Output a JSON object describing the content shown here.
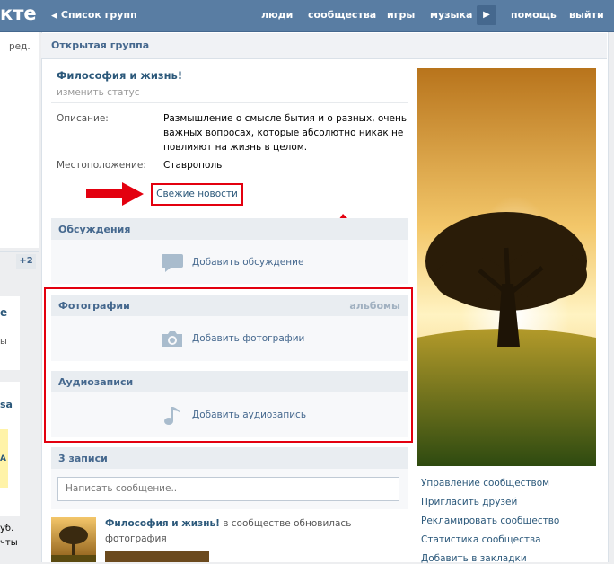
{
  "topbar": {
    "logo": "кте",
    "back_label": "Список групп",
    "nav": [
      "люди",
      "сообщества",
      "игры",
      "музыка",
      "помощь",
      "выйти"
    ]
  },
  "left": {
    "edit": "ред.",
    "badge": "+2",
    "frag1": "е",
    "frag2": "ы",
    "frag3": "sa",
    "frag4": "уб.",
    "frag5": "чты"
  },
  "group": {
    "header": "Открытая группа",
    "title": "Философия и жизнь!",
    "status": "изменить статус",
    "desc_label": "Описание:",
    "desc_lines": [
      "Размышление о смысле бытия и о разных, очень",
      "важных вопросах, которые абсолютно никак не",
      "повлияют на жизнь в целом."
    ],
    "loc_label": "Местоположение:",
    "loc_value": "Ставрополь",
    "news_link": "Свежие новости"
  },
  "sections": {
    "discussions": {
      "title": "Обсуждения",
      "add": "Добавить обсуждение"
    },
    "photos": {
      "title": "Фотографии",
      "right": "альбомы",
      "add": "Добавить фотографии"
    },
    "audio": {
      "title": "Аудиозаписи",
      "add": "Добавить аудиозапись"
    }
  },
  "wall": {
    "title": "3 записи",
    "placeholder": "Написать сообщение..",
    "post_author": "Философия и жизнь!",
    "post_text": " в сообществе обновилась",
    "post_text2": "фотография"
  },
  "right_links": [
    "Управление сообществом",
    "Пригласить друзей",
    "Рекламировать сообщество",
    "Статистика сообщества",
    "Добавить в закладки"
  ],
  "colors": {
    "brand": "#597da3",
    "link": "#2b587a",
    "highlight": "#e3000f"
  }
}
